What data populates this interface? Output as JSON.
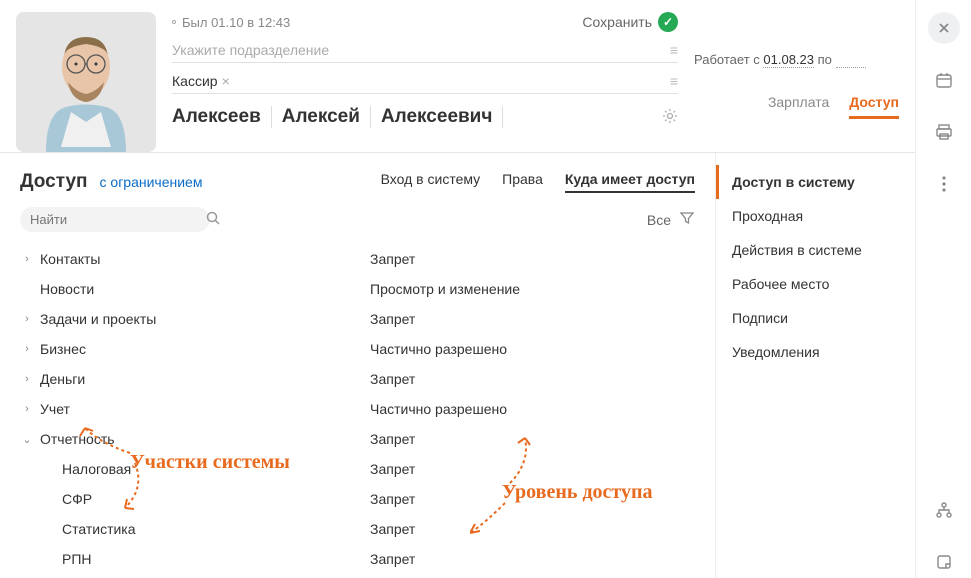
{
  "header": {
    "status": "Был 01.10 в 12:43",
    "save": "Сохранить",
    "department_placeholder": "Укажите подразделение",
    "position": "Кассир",
    "name": {
      "last": "Алексеев",
      "first": "Алексей",
      "middle": "Алексеевич"
    },
    "works_from_prefix": "Работает с",
    "works_from_date": "01.08.23",
    "works_to": "по"
  },
  "right_tabs": [
    {
      "label": "Зарплата",
      "active": false
    },
    {
      "label": "Доступ",
      "active": true
    }
  ],
  "section": {
    "title": "Доступ",
    "restriction": "с ограничением",
    "subtabs": [
      {
        "label": "Вход в систему",
        "active": false
      },
      {
        "label": "Права",
        "active": false
      },
      {
        "label": "Куда имеет доступ",
        "active": true
      }
    ],
    "search_placeholder": "Найти",
    "filter_all": "Все"
  },
  "tree": [
    {
      "label": "Контакты",
      "value": "Запрет",
      "expandable": true,
      "expanded": false,
      "indent": 0
    },
    {
      "label": "Новости",
      "value": "Просмотр и изменение",
      "expandable": false,
      "indent": 0
    },
    {
      "label": "Задачи и проекты",
      "value": "Запрет",
      "expandable": true,
      "expanded": false,
      "indent": 0
    },
    {
      "label": "Бизнес",
      "value": "Частично разрешено",
      "expandable": true,
      "expanded": false,
      "indent": 0
    },
    {
      "label": "Деньги",
      "value": "Запрет",
      "expandable": true,
      "expanded": false,
      "indent": 0
    },
    {
      "label": "Учет",
      "value": "Частично разрешено",
      "expandable": true,
      "expanded": false,
      "indent": 0
    },
    {
      "label": "Отчетность",
      "value": "Запрет",
      "expandable": true,
      "expanded": true,
      "indent": 0
    },
    {
      "label": "Налоговая",
      "value": "Запрет",
      "expandable": false,
      "indent": 1
    },
    {
      "label": "СФР",
      "value": "Запрет",
      "expandable": false,
      "indent": 1
    },
    {
      "label": "Статистика",
      "value": "Запрет",
      "expandable": false,
      "indent": 1
    },
    {
      "label": "РПН",
      "value": "Запрет",
      "expandable": false,
      "indent": 1
    }
  ],
  "sidebar": [
    {
      "label": "Доступ в систему",
      "active": true
    },
    {
      "label": "Проходная",
      "active": false
    },
    {
      "label": "Действия в системе",
      "active": false
    },
    {
      "label": "Рабочее место",
      "active": false
    },
    {
      "label": "Подписи",
      "active": false
    },
    {
      "label": "Уведомления",
      "active": false
    }
  ],
  "annotations": {
    "sections": "Участки системы",
    "levels": "Уровень доступа"
  }
}
